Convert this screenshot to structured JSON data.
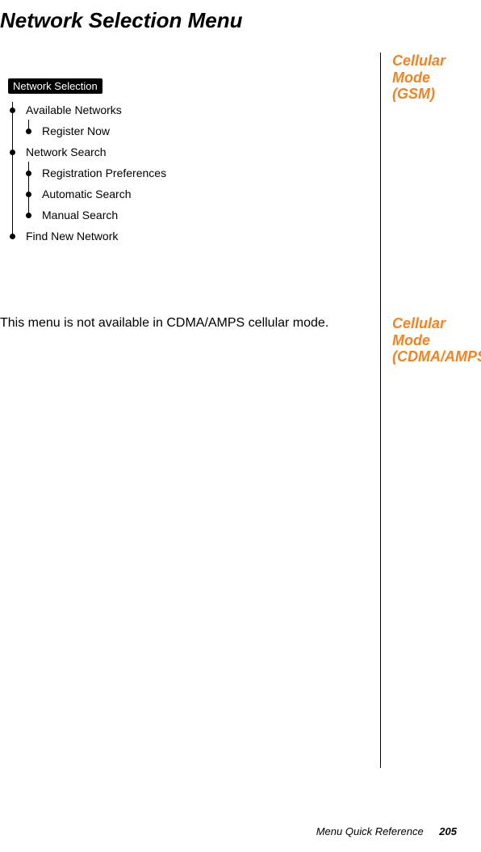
{
  "title": "Network Selection Menu",
  "side": {
    "gsm": "Cellular Mode (GSM)",
    "cdma": "Cellular Mode (CDMA/AMPS)"
  },
  "chip": "Network Selection",
  "menu": {
    "items": {
      "available_networks": "Available Networks",
      "register_now": "Register Now",
      "network_search": "Network Search",
      "registration_preferences": "Registration Preferences",
      "automatic_search": "Automatic Search",
      "manual_search": "Manual Search",
      "find_new_network": "Find New Network"
    }
  },
  "cdma_text": "This menu is not available in CDMA/AMPS cellular mode.",
  "footer": {
    "section": "Menu Quick Reference",
    "page": "205"
  }
}
